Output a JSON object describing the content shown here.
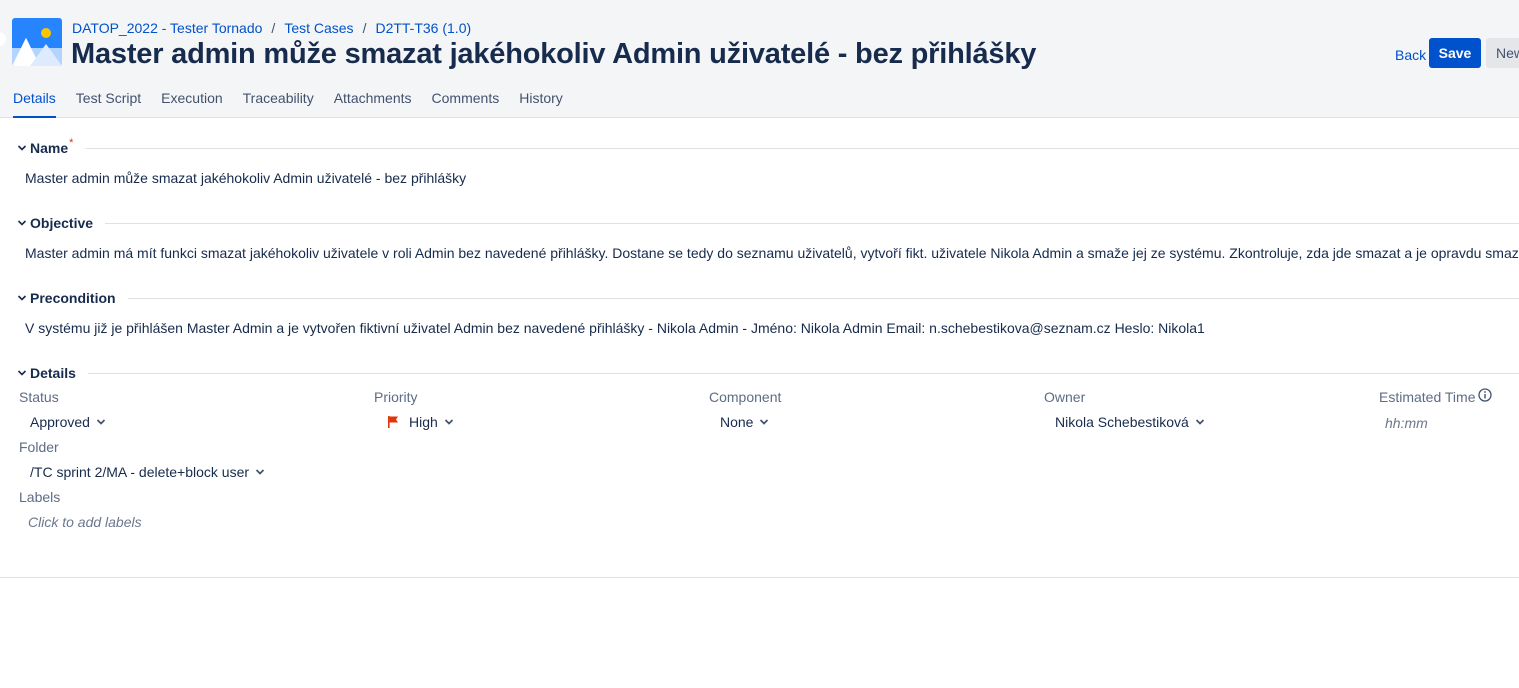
{
  "breadcrumb": {
    "project": "DATOP_2022 - Tester Tornado",
    "section": "Test Cases",
    "key": "D2TT-T36 (1.0)"
  },
  "title": "Master admin může smazat jakéhokoliv Admin uživatelé - bez přihlášky",
  "buttons": {
    "back": "Back",
    "save": "Save",
    "new": "New"
  },
  "tabs": [
    "Details",
    "Test Script",
    "Execution",
    "Traceability",
    "Attachments",
    "Comments",
    "History"
  ],
  "sections": {
    "name": {
      "title": "Name",
      "required": "*",
      "value": "Master admin může smazat jakéhokoliv Admin uživatelé - bez přihlášky"
    },
    "objective": {
      "title": "Objective",
      "value": "Master admin má mít funkci smazat jakéhokoliv uživatele v roli Admin bez navedené přihlášky. Dostane se tedy do seznamu uživatelů, vytvoří fikt. uživatele Nikola Admin a smaže jej ze systému. Zkontroluje, zda jde smazat a je opravdu smazán."
    },
    "precondition": {
      "title": "Precondition",
      "value": "V systému již je přihlášen Master Admin a je vytvořen fiktivní uživatel Admin bez navedené přihlášky - Nikola Admin - Jméno:  Nikola Admin Email: n.schebestikova@seznam.cz Heslo: Nikola1"
    },
    "details": {
      "title": "Details",
      "status": {
        "label": "Status",
        "value": "Approved"
      },
      "priority": {
        "label": "Priority",
        "value": "High",
        "flag_color": "#de350b"
      },
      "component": {
        "label": "Component",
        "value": "None"
      },
      "owner": {
        "label": "Owner",
        "value": "Nikola Schebestiková"
      },
      "estimated_time": {
        "label": "Estimated Time",
        "placeholder": "hh:mm"
      },
      "folder": {
        "label": "Folder",
        "value": "/TC sprint 2/MA - delete+block user"
      },
      "labels": {
        "label": "Labels",
        "placeholder": "Click to add labels"
      }
    }
  },
  "colors": {
    "accent": "#0052cc",
    "text": "#172b4d",
    "header_bg": "#f4f5f7"
  }
}
